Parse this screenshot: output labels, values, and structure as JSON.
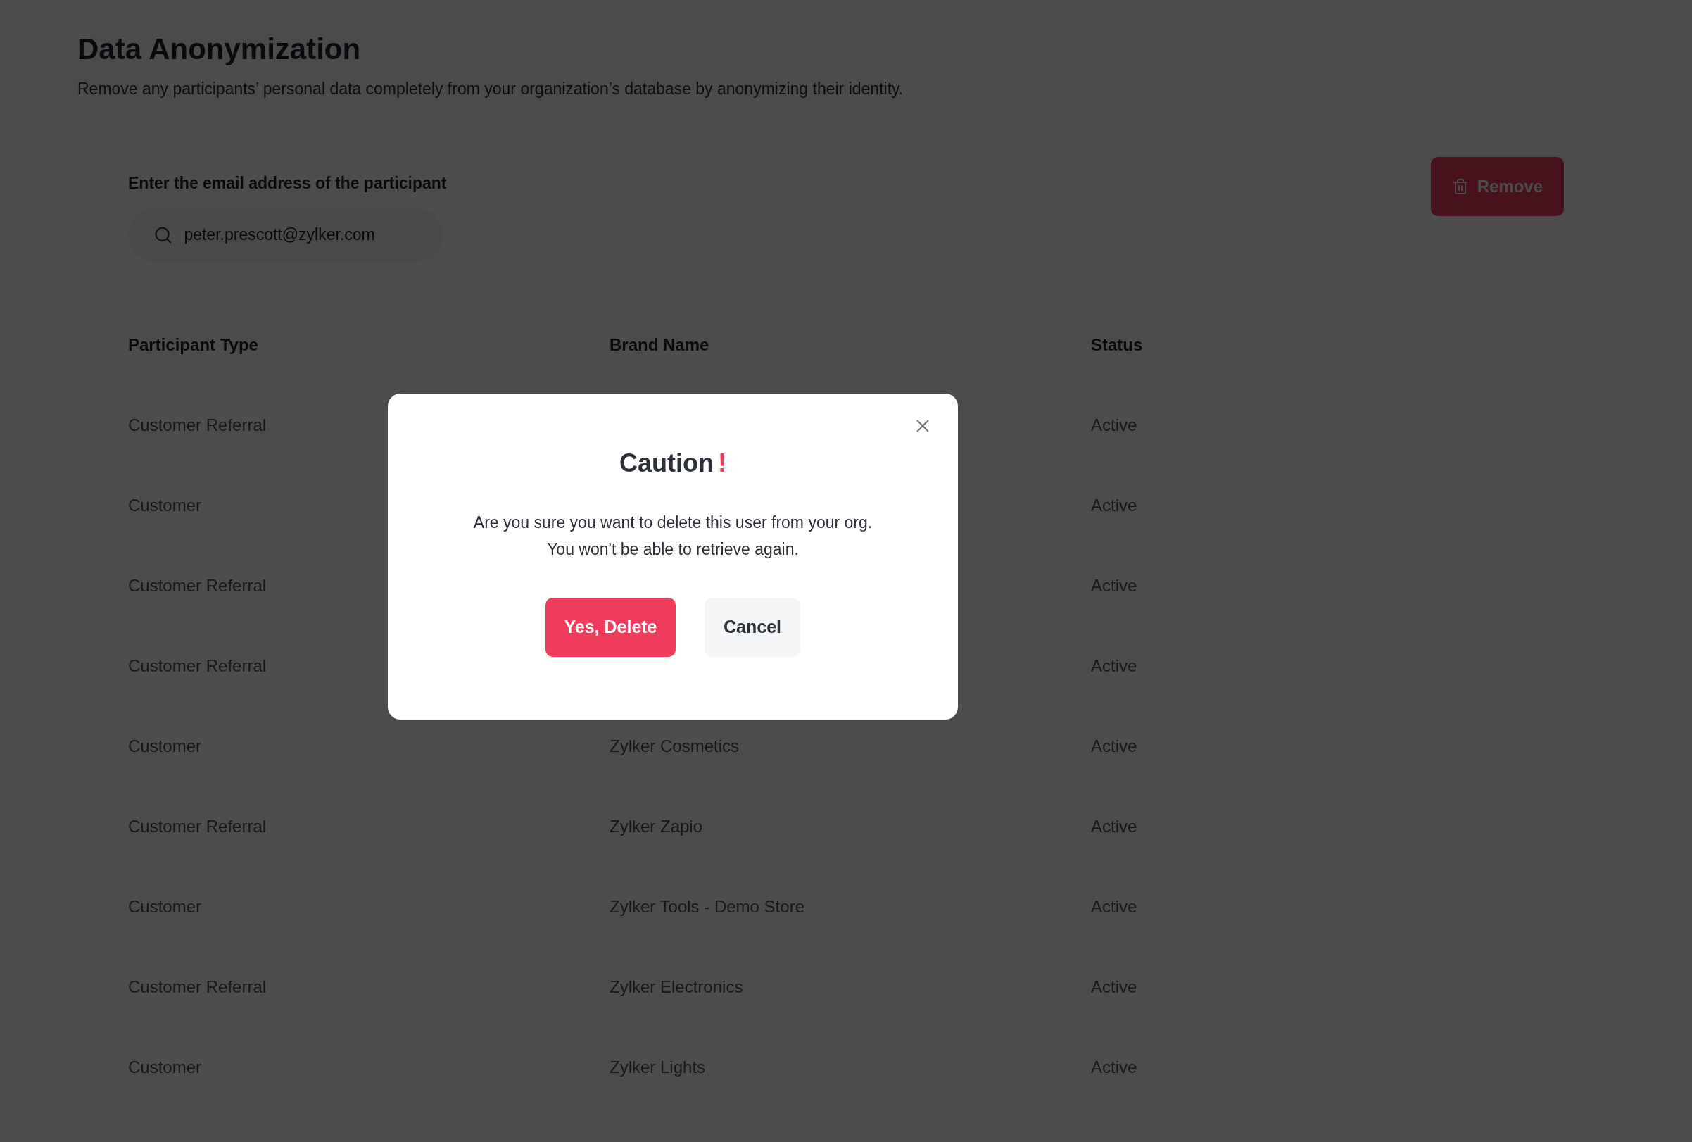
{
  "page": {
    "title": "Data Anonymization",
    "subtitle": "Remove any participants’ personal data completely from your organization’s database by anonymizing their identity."
  },
  "form": {
    "label": "Enter the email address of the participant",
    "search_value": "peter.prescott@zylker.com",
    "remove_button": "Remove"
  },
  "table": {
    "columns": [
      "Participant Type",
      "Brand Name",
      "Status"
    ],
    "rows": [
      {
        "type": "Customer Referral",
        "status": "Active"
      },
      {
        "type": "Customer",
        "status": "Active"
      },
      {
        "type": "Customer Referral",
        "status": "Active"
      },
      {
        "type": "Customer Referral",
        "status": "Active"
      },
      {
        "type": "Customer",
        "brand": "Zylker Cosmetics",
        "status": "Active"
      },
      {
        "type": "Customer Referral",
        "brand": "Zylker Zapio",
        "status": "Active"
      },
      {
        "type": "Customer",
        "brand": "Zylker Tools - Demo Store",
        "status": "Active"
      },
      {
        "type": "Customer Referral",
        "brand": "Zylker Electronics",
        "status": "Active"
      },
      {
        "type": "Customer",
        "brand": "Zylker Lights",
        "status": "Active"
      }
    ]
  },
  "dialog": {
    "title": "Caution",
    "title_mark": "!",
    "message_lines": [
      "Are you sure you want to delete this user from your org.",
      "You won't be able to retrieve again."
    ],
    "confirm_button": "Yes, Delete",
    "cancel_button": "Cancel"
  }
}
